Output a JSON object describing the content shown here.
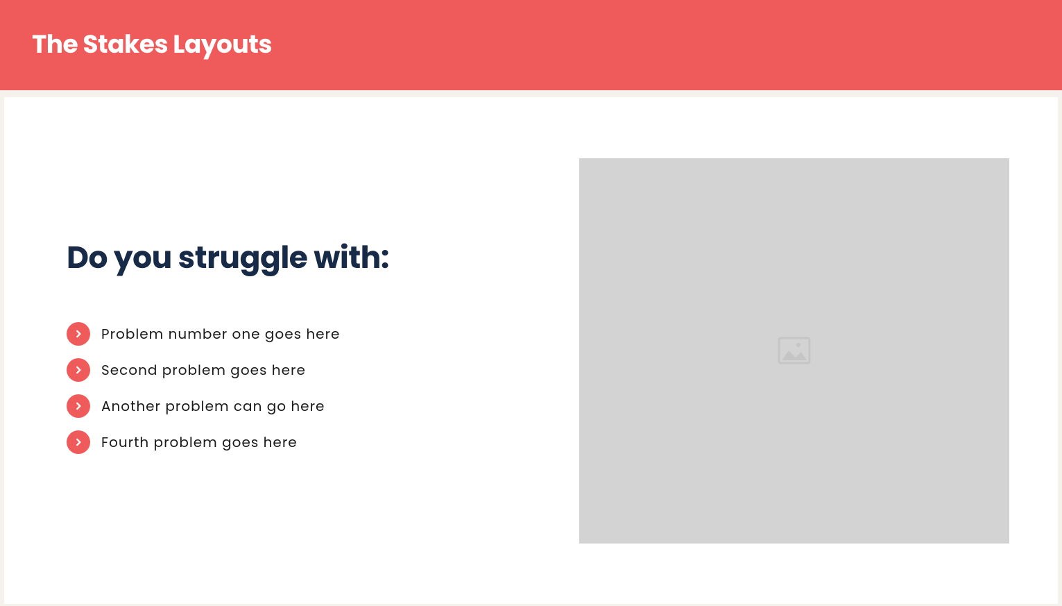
{
  "header": {
    "title": "The Stakes Layouts"
  },
  "main": {
    "heading": "Do you struggle with:",
    "problems": [
      "Problem number one goes here",
      "Second problem goes here",
      "Another problem can go here",
      "Fourth problem goes here"
    ]
  },
  "colors": {
    "accent": "#ef5a5a",
    "heading": "#172a47",
    "background": "#f5f2ed"
  }
}
